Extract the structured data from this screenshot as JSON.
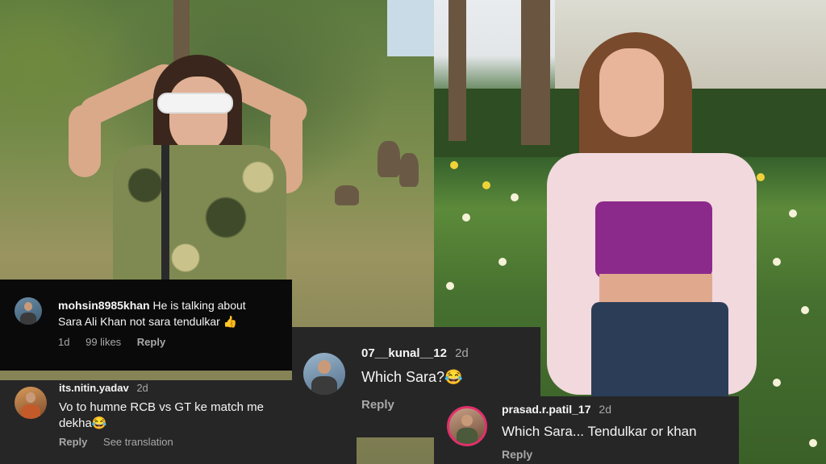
{
  "comments": [
    {
      "username": "mohsin8985khan",
      "text_line1": "He is talking about",
      "text_line2": "Sara Ali Khan not sara tendulkar 👍",
      "time": "1d",
      "likes": "99 likes",
      "reply": "Reply"
    },
    {
      "username": "its.nitin.yadav",
      "time": "2d",
      "text_line1": "Vo to humne RCB vs GT ke match me",
      "text_line2": "dekha😂",
      "reply": "Reply",
      "translate": "See translation"
    },
    {
      "username": "07__kunal__12",
      "time": "2d",
      "text": "Which Sara?😂",
      "reply": "Reply"
    },
    {
      "username": "prasad.r.patil_17",
      "time": "2d",
      "text": "Which Sara... Tendulkar or khan",
      "reply": "Reply"
    }
  ],
  "colors": {
    "comment_bg": "#262626",
    "comment_bg_dark": "#0a0a0a",
    "text": "#f5f5f5",
    "muted": "#a8a8a8",
    "story_ring": "#e1306c"
  }
}
